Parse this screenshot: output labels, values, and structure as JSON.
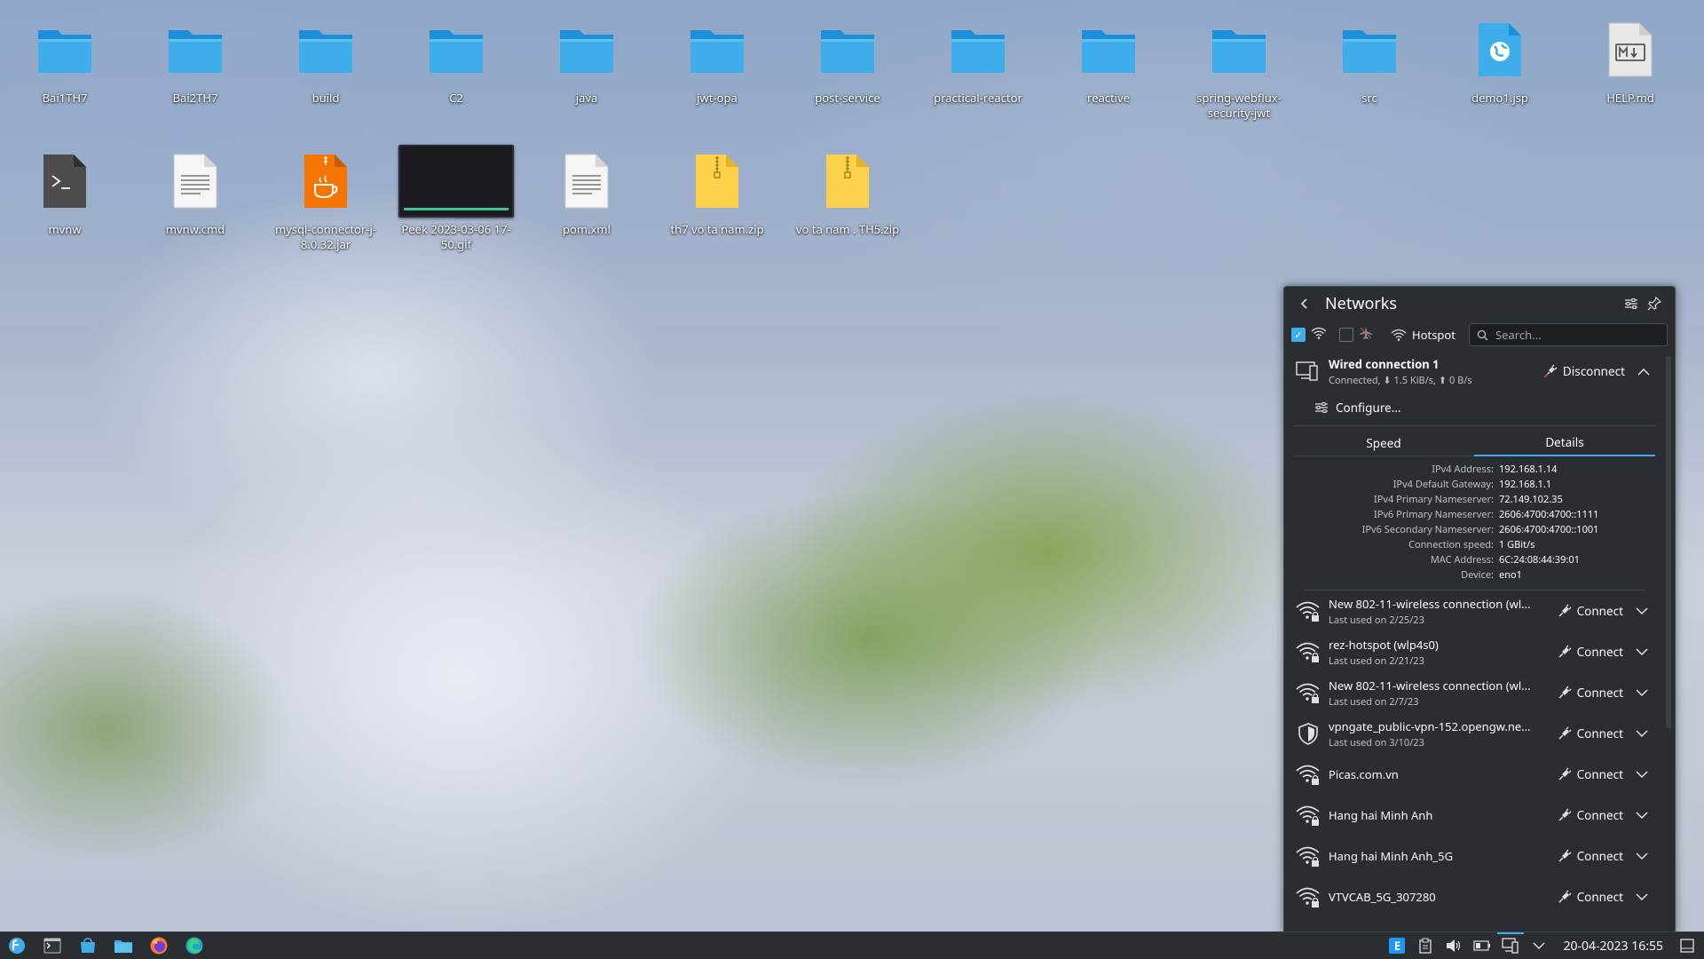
{
  "desktop": {
    "row1": [
      {
        "label": "Bai1TH7",
        "icon": "folder-icon"
      },
      {
        "label": "Bai2TH7",
        "icon": "folder-icon"
      },
      {
        "label": "build",
        "icon": "folder-icon"
      },
      {
        "label": "C2",
        "icon": "folder-icon"
      },
      {
        "label": "java",
        "icon": "folder-icon"
      },
      {
        "label": "jwt-opa",
        "icon": "folder-icon"
      },
      {
        "label": "post-service",
        "icon": "folder-icon"
      },
      {
        "label": "practical-reactor",
        "icon": "folder-icon"
      },
      {
        "label": "reactive",
        "icon": "folder-icon"
      },
      {
        "label": "spring-webflux-security-jwt",
        "icon": "folder-icon"
      },
      {
        "label": "src",
        "icon": "folder-icon"
      },
      {
        "label": "demo1.jsp",
        "icon": "web-file-icon"
      },
      {
        "label": "HELP.md",
        "icon": "markdown-file-icon"
      }
    ],
    "row2": [
      {
        "label": "mvnw",
        "icon": "terminal-script-icon"
      },
      {
        "label": "mvnw.cmd",
        "icon": "text-file-icon"
      },
      {
        "label": "mysql-connector-j-8.0.32.jar",
        "icon": "java-archive-icon"
      },
      {
        "label": "Peek 2023-03-06 17-50.gif",
        "icon": "gif-thumbnail"
      },
      {
        "label": "pom.xml",
        "icon": "text-file-icon"
      },
      {
        "label": "th7 vo ta nam.zip",
        "icon": "zip-archive-icon"
      },
      {
        "label": "vo ta nam . TH5.zip",
        "icon": "zip-archive-icon"
      }
    ]
  },
  "networks": {
    "title": "Networks",
    "hotspot_label": "Hotspot",
    "search_placeholder": "Search...",
    "wired": {
      "name": "Wired connection 1",
      "status": "Connected, ⬇ 1.5 KiB/s, ⬆ 0 B/s",
      "action": "Disconnect",
      "configure": "Configure...",
      "tabs": [
        "Speed",
        "Details"
      ],
      "active_tab": "Details",
      "details": [
        {
          "key": "IPv4 Address:",
          "value": "192.168.1.14"
        },
        {
          "key": "IPv4 Default Gateway:",
          "value": "192.168.1.1"
        },
        {
          "key": "IPv4 Primary Nameserver:",
          "value": "72.149.102.35"
        },
        {
          "key": "IPv6 Primary Nameserver:",
          "value": "2606:4700:4700::1111"
        },
        {
          "key": "IPv6 Secondary Nameserver:",
          "value": "2606:4700:4700::1001"
        },
        {
          "key": "Connection speed:",
          "value": "1 GBit/s"
        },
        {
          "key": "MAC Address:",
          "value": "6C:24:08:44:39:01"
        },
        {
          "key": "Device:",
          "value": "eno1"
        }
      ]
    },
    "connections": [
      {
        "name": "New 802-11-wireless connection (wl...",
        "sub": "Last used on 2/25/23",
        "icon": "wifi-locked-icon",
        "action": "Connect"
      },
      {
        "name": "rez-hotspot (wlp4s0)",
        "sub": "Last used on 2/21/23",
        "icon": "wifi-locked-icon",
        "action": "Connect"
      },
      {
        "name": "New 802-11-wireless connection (wl...",
        "sub": "Last used on 2/7/23",
        "icon": "wifi-locked-icon",
        "action": "Connect"
      },
      {
        "name": "vpngate_public-vpn-152.opengw.net...",
        "sub": "Last used on 3/10/23",
        "icon": "vpn-shield-icon",
        "action": "Connect"
      },
      {
        "name": "Picas.com.vn",
        "sub": "",
        "icon": "wifi-locked-icon",
        "action": "Connect"
      },
      {
        "name": "Hang hai Minh Anh",
        "sub": "",
        "icon": "wifi-locked-icon",
        "action": "Connect"
      },
      {
        "name": "Hang hai Minh Anh_5G",
        "sub": "",
        "icon": "wifi-locked-icon",
        "action": "Connect"
      },
      {
        "name": "VTVCAB_5G_307280",
        "sub": "",
        "icon": "wifi-locked-icon",
        "action": "Connect"
      }
    ]
  },
  "taskbar": {
    "datetime": "20-04-2023  16:55"
  },
  "colors": {
    "accent": "#3daee9",
    "panel_bg": "#2a2e32",
    "folder": "#3daee9"
  }
}
